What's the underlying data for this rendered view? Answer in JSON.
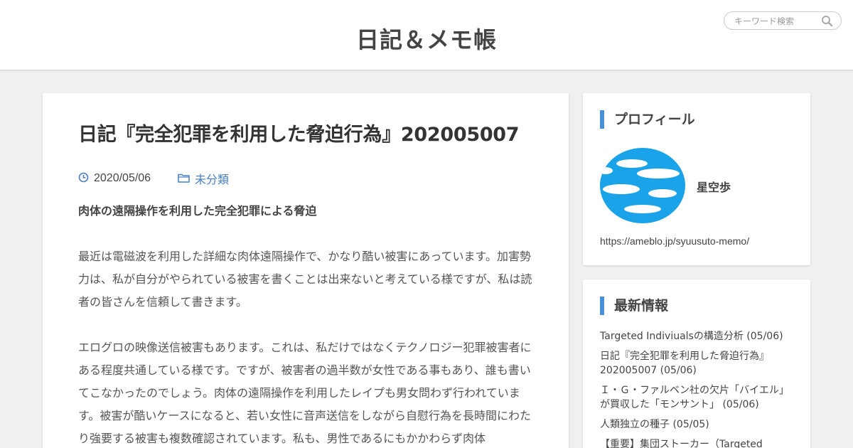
{
  "header": {
    "site_title": "日記＆メモ帳",
    "search_placeholder": "キーワード検索"
  },
  "post": {
    "title": "日記『完全犯罪を利用した脅迫行為』202005007",
    "date": "2020/05/06",
    "category": "未分類",
    "lead": "肉体の遠隔操作を利用した完全犯罪による脅迫",
    "paragraph1": "最近は電磁波を利用した詳細な肉体遠隔操作で、かなり酷い被害にあっています。加害勢力は、私が自分がやられている被害を書くことは出来ないと考えている様ですが、私は読者の皆さんを信頼して書きます。",
    "paragraph2": "エログロの映像送信被害もあります。これは、私だけではなくテクノロジー犯罪被害者にある程度共通している様です。ですが、被害者の過半数が女性である事もあり、誰も書いてこなかったのでしょう。肉体の遠隔操作を利用したレイプも男女問わず行われています。被害が酷いケースになると、若い女性に音声送信をしながら自慰行為を長時間にわたり強要する被害も複数確認されています。私も、男性であるにもかかわらず肉体"
  },
  "profile": {
    "title": "プロフィール",
    "name": "星空歩",
    "url": "https://ameblo.jp/syuusuto-memo/"
  },
  "latest": {
    "title": "最新情報",
    "items": [
      "Targeted Indiviualsの構造分析 (05/06)",
      "日記『完全犯罪を利用した脅迫行為』202005007 (05/06)",
      "Ｉ・Ｇ・ファルベン社の欠片「バイエル」が買収した「モンサント」 (05/06)",
      "人類独立の種子 (05/05)",
      "【重要】集団ストーカー（Targeted"
    ]
  },
  "colors": {
    "accent": "#4a90d9",
    "link": "#4a7fc6",
    "background": "#f0f0f0"
  },
  "icons": {
    "search": "search-icon",
    "date": "clock-icon",
    "category": "folder-icon"
  }
}
